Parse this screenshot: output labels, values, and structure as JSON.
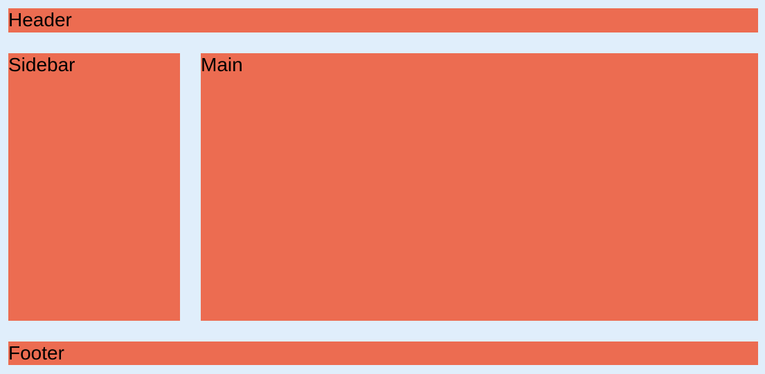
{
  "colors": {
    "background": "#e0eefb",
    "box": "#ec6c51",
    "text": "#000000"
  },
  "layout": {
    "header": {
      "label": "Header"
    },
    "sidebar": {
      "label": "Sidebar"
    },
    "main": {
      "label": "Main"
    },
    "footer": {
      "label": "Footer"
    }
  }
}
